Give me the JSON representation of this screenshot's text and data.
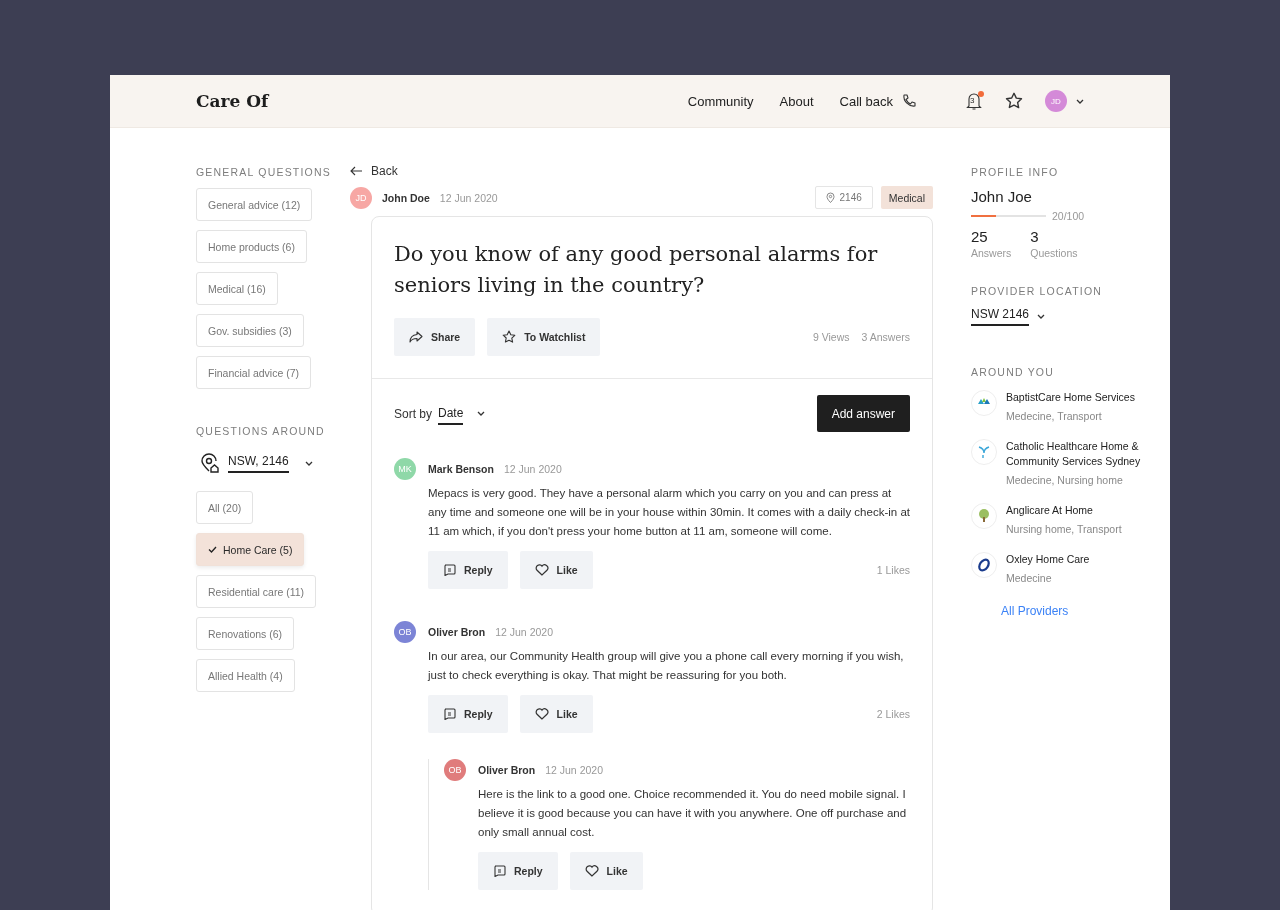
{
  "header": {
    "logo": "Care Of",
    "nav": [
      {
        "label": "Community",
        "kind": "link"
      },
      {
        "label": "About",
        "kind": "link"
      },
      {
        "label": "Call back",
        "kind": "phone"
      }
    ],
    "notifications": "3",
    "avatar": "JD"
  },
  "left": {
    "general_title": "GENERAL QUESTIONS",
    "general": [
      {
        "label": "General advice (12)",
        "selected": false
      },
      {
        "label": "Home products (6)",
        "selected": false
      },
      {
        "label": "Medical (16)",
        "selected": false
      },
      {
        "label": "Gov. subsidies (3)",
        "selected": false
      },
      {
        "label": "Financial advice (7)",
        "selected": false
      }
    ],
    "around_title": "QUESTIONS AROUND",
    "location": "NSW, 2146",
    "around": [
      {
        "label": "All (20)",
        "selected": false
      },
      {
        "label": "Home Care (5)",
        "selected": true
      },
      {
        "label": "Residential care (11)",
        "selected": false
      },
      {
        "label": "Renovations (6)",
        "selected": false
      },
      {
        "label": "Allied Health (4)",
        "selected": false
      }
    ]
  },
  "question": {
    "back": "Back",
    "author": {
      "initials": "JD",
      "name": "John Doe",
      "date": "12 Jun 2020",
      "color": "#f7a7a4"
    },
    "postcode": "2146",
    "category": "Medical",
    "title": "Do you know of any good personal alarms for seniors living in the country?",
    "actions": [
      {
        "label": "Share",
        "kind": "share"
      },
      {
        "label": "To Watchlist",
        "kind": "star"
      }
    ],
    "views": "9 Views",
    "answers_count": "3 Answers"
  },
  "sort": {
    "label": "Sort by",
    "value": "Date"
  },
  "add_answer": "Add answer",
  "answers": [
    {
      "initials": "MK",
      "name": "Mark Benson",
      "date": "12 Jun 2020",
      "color": "#8fd8a8",
      "text": "Mepacs is very good. They have a personal alarm which you carry on you and can press at any time and someone one will be in your house within 30min. It comes with a daily check-in at 11 am which, if you don't press your home button at 11 am, someone will come.",
      "reply": "Reply",
      "like": "Like",
      "likes": "1 Likes"
    },
    {
      "initials": "OB",
      "name": "Oliver Bron",
      "date": "12 Jun 2020",
      "color": "#7c84d6",
      "text": "In our area, our Community Health group will give you a phone call every morning if you wish, just to check everything is okay. That might be reassuring for you both.",
      "reply": "Reply",
      "like": "Like",
      "likes": "2 Likes",
      "children": [
        {
          "initials": "OB",
          "name": "Oliver Bron",
          "date": "12 Jun 2020",
          "color": "#e07c7c",
          "text": "Here is the link to a good one. Choice recommended it. You do need mobile signal. I believe it is good because you can have it with you anywhere. One off purchase and only small annual cost.",
          "reply": "Reply",
          "like": "Like"
        }
      ]
    }
  ],
  "right": {
    "profile_title": "PROFILE INFO",
    "name": "John Joe",
    "level": 0.33,
    "score": "20/100",
    "stats": [
      {
        "value": "25",
        "label": "Answers"
      },
      {
        "value": "3",
        "label": "Questions"
      }
    ],
    "location_title": "PROVIDER LOCATION",
    "location": "NSW 2146",
    "around_title": "AROUND YOU",
    "providers": [
      {
        "name": "BaptistCare Home Services",
        "tags": "Medecine, Transport",
        "kind": "hands"
      },
      {
        "name": "Catholic Healthcare Home & Community Services Sydney",
        "tags": "Medecine, Nursing home",
        "kind": "swirl"
      },
      {
        "name": "Anglicare At Home",
        "tags": "Nursing home, Transport",
        "kind": "tree"
      },
      {
        "name": "Oxley Home Care",
        "tags": "Medecine",
        "kind": "ring"
      }
    ],
    "all_link": "All Providers"
  }
}
